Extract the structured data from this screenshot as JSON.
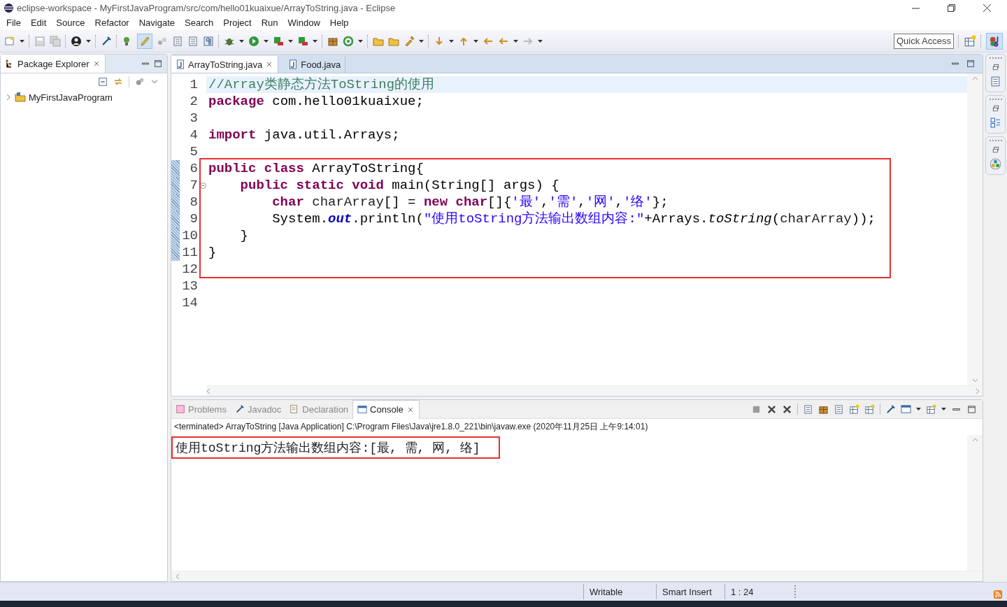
{
  "window": {
    "title": "eclipse-workspace - MyFirstJavaProgram/src/com/hello01kuaixue/ArrayToString.java - Eclipse"
  },
  "menu": [
    "File",
    "Edit",
    "Source",
    "Refactor",
    "Navigate",
    "Search",
    "Project",
    "Run",
    "Window",
    "Help"
  ],
  "quick_access": {
    "placeholder": "Quick Access"
  },
  "package_explorer": {
    "title": "Package Explorer",
    "tree": [
      {
        "label": "MyFirstJavaProgram",
        "expanded": false
      }
    ]
  },
  "editor": {
    "tabs": [
      {
        "label": "ArrayToString.java",
        "selected": true
      },
      {
        "label": "Food.java",
        "selected": false
      }
    ],
    "lines": [
      {
        "number": "1",
        "current": true,
        "changed": false,
        "framed": false,
        "foldable": false,
        "tokens": [
          {
            "kind": "comment",
            "text": "//Array类静态方法ToString的使用"
          }
        ]
      },
      {
        "number": "2",
        "current": false,
        "changed": false,
        "framed": false,
        "foldable": false,
        "tokens": [
          {
            "kind": "keyword",
            "text": "package"
          },
          {
            "kind": "plain",
            "text": " com.hello01kuaixue;"
          }
        ]
      },
      {
        "number": "3",
        "current": false,
        "changed": false,
        "framed": false,
        "foldable": false
      },
      {
        "number": "4",
        "current": false,
        "changed": false,
        "framed": false,
        "foldable": false,
        "tokens": [
          {
            "kind": "keyword",
            "text": "import"
          },
          {
            "kind": "plain",
            "text": " java.util.Arrays;"
          }
        ]
      },
      {
        "number": "5",
        "current": false,
        "changed": false,
        "framed": false,
        "foldable": false
      },
      {
        "number": "6",
        "current": false,
        "changed": true,
        "framed": true,
        "foldable": false,
        "tokens": [
          {
            "kind": "keyword",
            "text": "public "
          },
          {
            "kind": "keyword",
            "text": "class"
          },
          {
            "kind": "plain",
            "text": " ArrayToString{"
          }
        ]
      },
      {
        "number": "7",
        "current": false,
        "changed": true,
        "framed": true,
        "foldable": true,
        "tokens": [
          {
            "kind": "keyword",
            "text": "    public "
          },
          {
            "kind": "keyword",
            "text": "static "
          },
          {
            "kind": "keyword",
            "text": "void"
          },
          {
            "kind": "plain",
            "text": " main(String[] args) {"
          }
        ]
      },
      {
        "number": "8",
        "current": false,
        "changed": true,
        "framed": true,
        "foldable": false,
        "tokens": [
          {
            "kind": "keyword",
            "text": "        char"
          },
          {
            "kind": "variable",
            "text": " charArray"
          },
          {
            "kind": "plain",
            "text": "[] = "
          },
          {
            "kind": "keyword",
            "text": "new "
          },
          {
            "kind": "keyword",
            "text": "char"
          },
          {
            "kind": "plain",
            "text": "[]{"
          },
          {
            "kind": "string",
            "text": "'最'"
          },
          {
            "kind": "plain",
            "text": ","
          },
          {
            "kind": "string",
            "text": "'需'"
          },
          {
            "kind": "plain",
            "text": ","
          },
          {
            "kind": "string",
            "text": "'网'"
          },
          {
            "kind": "plain",
            "text": ","
          },
          {
            "kind": "string",
            "text": "'络'"
          },
          {
            "kind": "plain",
            "text": "};"
          }
        ]
      },
      {
        "number": "9",
        "current": false,
        "changed": true,
        "framed": true,
        "foldable": false,
        "tokens": [
          {
            "kind": "plain",
            "text": "        System."
          },
          {
            "kind": "static-field",
            "text": "out"
          },
          {
            "kind": "plain",
            "text": ".println("
          },
          {
            "kind": "string",
            "text": "\"使用toString方法输出数组内容:\""
          },
          {
            "kind": "plain",
            "text": "+Arrays."
          },
          {
            "kind": "static-method",
            "text": "toString"
          },
          {
            "kind": "plain",
            "text": "("
          },
          {
            "kind": "variable",
            "text": "charArray"
          },
          {
            "kind": "plain",
            "text": "));"
          }
        ]
      },
      {
        "number": "10",
        "current": false,
        "changed": true,
        "framed": true,
        "foldable": false,
        "tokens": [
          {
            "kind": "plain",
            "text": "    }"
          }
        ]
      },
      {
        "number": "11",
        "current": false,
        "changed": true,
        "framed": true,
        "foldable": false,
        "tokens": [
          {
            "kind": "plain",
            "text": "}"
          }
        ]
      },
      {
        "number": "12",
        "current": false,
        "changed": false,
        "framed": true,
        "foldable": false
      },
      {
        "number": "13",
        "current": false,
        "changed": false,
        "framed": false,
        "foldable": false
      },
      {
        "number": "14",
        "current": false,
        "changed": false,
        "framed": false,
        "foldable": false
      }
    ]
  },
  "console": {
    "tabs": [
      {
        "label": "Problems",
        "selected": false
      },
      {
        "label": "Javadoc",
        "selected": false
      },
      {
        "label": "Declaration",
        "selected": false
      },
      {
        "label": "Console",
        "selected": true
      }
    ],
    "header": "<terminated> ArrayToString [Java Application] C:\\Program Files\\Java\\jre1.8.0_221\\bin\\javaw.exe (2020年11月25日 上午9:14:01)",
    "output": "使用toString方法输出数组内容:[最, 需, 网, 络]",
    "framed": true
  },
  "status_bar": [
    "Writable",
    "Smart Insert",
    "1 : 24"
  ]
}
